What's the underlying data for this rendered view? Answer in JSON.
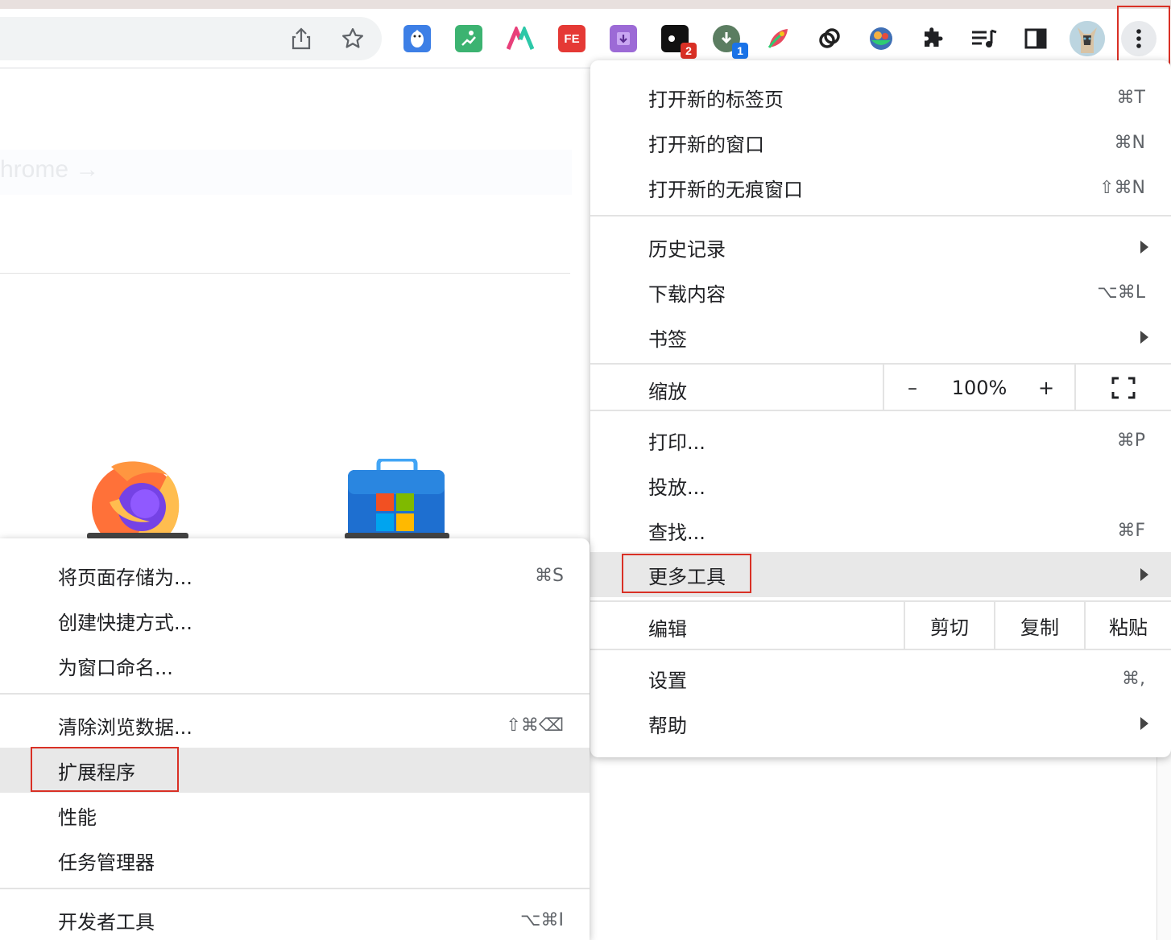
{
  "colors": {
    "highlight_outline": "#d93025",
    "hover_row": "#e8e8e8",
    "separator": "#e3e3e3"
  },
  "toolbar": {
    "share_icon": "share-icon",
    "bookmark_icon": "star-icon",
    "extensions": [
      {
        "name": "penguin-extension-icon"
      },
      {
        "name": "green-skater-extension-icon"
      },
      {
        "name": "m-logo-extension-icon"
      },
      {
        "name": "fe-extension-icon",
        "text": "FE"
      },
      {
        "name": "purple-download-extension-icon"
      },
      {
        "name": "black-game-extension-icon",
        "badge": "2"
      },
      {
        "name": "green-download-extension-icon",
        "badge": "1"
      },
      {
        "name": "colorful-leaf-extension-icon"
      },
      {
        "name": "link-extension-icon"
      },
      {
        "name": "bowl-extension-icon"
      }
    ],
    "puzzle_icon": "puzzle-icon",
    "media_icon": "media-queue-icon",
    "side_panel_icon": "side-panel-icon",
    "avatar": "profile-avatar",
    "menu_icon": "kebab-menu-icon"
  },
  "page": {
    "ghost_text": "hrome →"
  },
  "main_menu": {
    "new_tab": {
      "label": "打开新的标签页",
      "shortcut": "⌘T"
    },
    "new_window": {
      "label": "打开新的窗口",
      "shortcut": "⌘N"
    },
    "incognito": {
      "label": "打开新的无痕窗口",
      "shortcut": "⇧⌘N"
    },
    "history": {
      "label": "历史记录"
    },
    "downloads": {
      "label": "下载内容",
      "shortcut": "⌥⌘L"
    },
    "bookmarks": {
      "label": "书签"
    },
    "zoom": {
      "label": "缩放",
      "minus": "–",
      "value": "100%",
      "plus": "+"
    },
    "print": {
      "label": "打印...",
      "shortcut": "⌘P"
    },
    "cast": {
      "label": "投放..."
    },
    "find": {
      "label": "查找...",
      "shortcut": "⌘F"
    },
    "more_tools": {
      "label": "更多工具"
    },
    "edit": {
      "label": "编辑",
      "cut": "剪切",
      "copy": "复制",
      "paste": "粘贴"
    },
    "settings": {
      "label": "设置",
      "shortcut": "⌘,"
    },
    "help": {
      "label": "帮助"
    }
  },
  "sub_menu": {
    "save_page": {
      "label": "将页面存储为...",
      "shortcut": "⌘S"
    },
    "create_shortcut": {
      "label": "创建快捷方式..."
    },
    "name_window": {
      "label": "为窗口命名..."
    },
    "clear_data": {
      "label": "清除浏览数据...",
      "shortcut": "⇧⌘⌫"
    },
    "extensions": {
      "label": "扩展程序"
    },
    "performance": {
      "label": "性能"
    },
    "task_manager": {
      "label": "任务管理器"
    },
    "dev_tools": {
      "label": "开发者工具",
      "shortcut": "⌥⌘I"
    }
  }
}
